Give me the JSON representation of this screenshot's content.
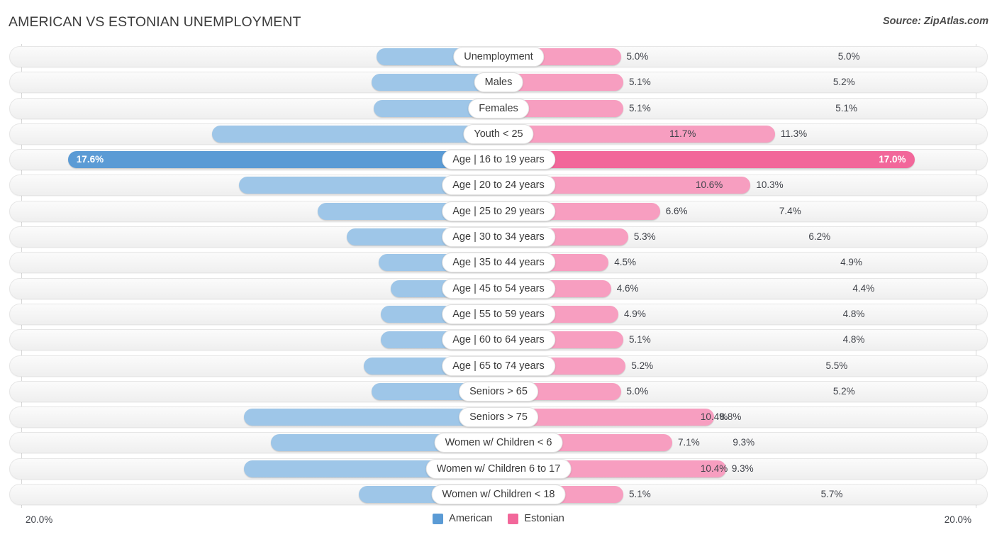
{
  "header": {
    "title": "AMERICAN VS ESTONIAN UNEMPLOYMENT",
    "source": "Source: ZipAtlas.com"
  },
  "axis": {
    "min_label": "20.0%",
    "max_label": "20.0%",
    "max_value": 20.0
  },
  "legend": {
    "items": [
      {
        "label": "American",
        "color": "#5B9BD5"
      },
      {
        "label": "Estonian",
        "color": "#F2679A"
      }
    ]
  },
  "colors": {
    "american_light": "#9EC6E8",
    "american_dark": "#5B9BD5",
    "estonian_light": "#F79EC0",
    "estonian_dark": "#F2679A",
    "track": "#f4f4f4",
    "text": "#40434a"
  },
  "chart_data": {
    "type": "bar",
    "subtype": "diverging-bidirectional",
    "title": "AMERICAN VS ESTONIAN UNEMPLOYMENT",
    "xlabel": "",
    "ylabel": "",
    "xlim": [
      20.0,
      20.0
    ],
    "grid": false,
    "legend_position": "bottom-center",
    "unit": "%",
    "categories": [
      "Unemployment",
      "Males",
      "Females",
      "Youth < 25",
      "Age | 16 to 19 years",
      "Age | 20 to 24 years",
      "Age | 25 to 29 years",
      "Age | 30 to 34 years",
      "Age | 35 to 44 years",
      "Age | 45 to 54 years",
      "Age | 55 to 59 years",
      "Age | 60 to 64 years",
      "Age | 65 to 74 years",
      "Seniors > 65",
      "Seniors > 75",
      "Women w/ Children < 6",
      "Women w/ Children 6 to 17",
      "Women w/ Children < 18"
    ],
    "series": [
      {
        "name": "American",
        "side": "left",
        "values": [
          5.0,
          5.2,
          5.1,
          11.7,
          17.6,
          10.6,
          7.4,
          6.2,
          4.9,
          4.4,
          4.8,
          4.8,
          5.5,
          5.2,
          10.4,
          9.3,
          10.4,
          5.7
        ]
      },
      {
        "name": "Estonian",
        "side": "right",
        "values": [
          5.0,
          5.1,
          5.1,
          11.3,
          17.0,
          10.3,
          6.6,
          5.3,
          4.5,
          4.6,
          4.9,
          5.1,
          5.2,
          5.0,
          8.8,
          7.1,
          9.3,
          5.1
        ]
      }
    ]
  },
  "rows": [
    {
      "label": "Unemployment",
      "left_value": 5.0,
      "left_text": "5.0%",
      "right_value": 5.0,
      "right_text": "5.0%",
      "highlight": false
    },
    {
      "label": "Males",
      "left_value": 5.2,
      "left_text": "5.2%",
      "right_value": 5.1,
      "right_text": "5.1%",
      "highlight": false
    },
    {
      "label": "Females",
      "left_value": 5.1,
      "left_text": "5.1%",
      "right_value": 5.1,
      "right_text": "5.1%",
      "highlight": false
    },
    {
      "label": "Youth < 25",
      "left_value": 11.7,
      "left_text": "11.7%",
      "right_value": 11.3,
      "right_text": "11.3%",
      "highlight": false
    },
    {
      "label": "Age | 16 to 19 years",
      "left_value": 17.6,
      "left_text": "17.6%",
      "right_value": 17.0,
      "right_text": "17.0%",
      "highlight": true
    },
    {
      "label": "Age | 20 to 24 years",
      "left_value": 10.6,
      "left_text": "10.6%",
      "right_value": 10.3,
      "right_text": "10.3%",
      "highlight": false
    },
    {
      "label": "Age | 25 to 29 years",
      "left_value": 7.4,
      "left_text": "7.4%",
      "right_value": 6.6,
      "right_text": "6.6%",
      "highlight": false
    },
    {
      "label": "Age | 30 to 34 years",
      "left_value": 6.2,
      "left_text": "6.2%",
      "right_value": 5.3,
      "right_text": "5.3%",
      "highlight": false
    },
    {
      "label": "Age | 35 to 44 years",
      "left_value": 4.9,
      "left_text": "4.9%",
      "right_value": 4.5,
      "right_text": "4.5%",
      "highlight": false
    },
    {
      "label": "Age | 45 to 54 years",
      "left_value": 4.4,
      "left_text": "4.4%",
      "right_value": 4.6,
      "right_text": "4.6%",
      "highlight": false
    },
    {
      "label": "Age | 55 to 59 years",
      "left_value": 4.8,
      "left_text": "4.8%",
      "right_value": 4.9,
      "right_text": "4.9%",
      "highlight": false
    },
    {
      "label": "Age | 60 to 64 years",
      "left_value": 4.8,
      "left_text": "4.8%",
      "right_value": 5.1,
      "right_text": "5.1%",
      "highlight": false
    },
    {
      "label": "Age | 65 to 74 years",
      "left_value": 5.5,
      "left_text": "5.5%",
      "right_value": 5.2,
      "right_text": "5.2%",
      "highlight": false
    },
    {
      "label": "Seniors > 65",
      "left_value": 5.2,
      "left_text": "5.2%",
      "right_value": 5.0,
      "right_text": "5.0%",
      "highlight": false
    },
    {
      "label": "Seniors > 75",
      "left_value": 10.4,
      "left_text": "10.4%",
      "right_value": 8.8,
      "right_text": "8.8%",
      "highlight": false
    },
    {
      "label": "Women w/ Children < 6",
      "left_value": 9.3,
      "left_text": "9.3%",
      "right_value": 7.1,
      "right_text": "7.1%",
      "highlight": false
    },
    {
      "label": "Women w/ Children 6 to 17",
      "left_value": 10.4,
      "left_text": "10.4%",
      "right_value": 9.3,
      "right_text": "9.3%",
      "highlight": false
    },
    {
      "label": "Women w/ Children < 18",
      "left_value": 5.7,
      "left_text": "5.7%",
      "right_value": 5.1,
      "right_text": "5.1%",
      "highlight": false
    }
  ]
}
